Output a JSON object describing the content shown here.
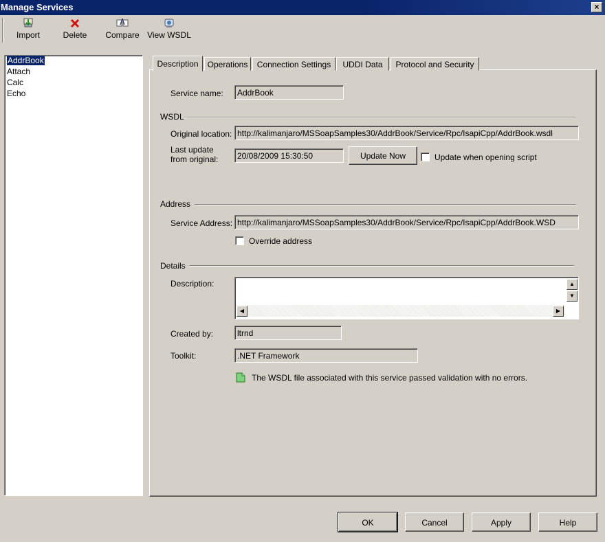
{
  "window": {
    "title": "Manage Services",
    "close_glyph": "×"
  },
  "toolbar": {
    "buttons": [
      {
        "label": "Import",
        "icon": "import-icon"
      },
      {
        "label": "Delete",
        "icon": "delete-icon"
      },
      {
        "label": "Compare",
        "icon": "compare-icon"
      },
      {
        "label": "View WSDL",
        "icon": "view-wsdl-icon"
      }
    ]
  },
  "services": [
    "AddrBook",
    "Attach",
    "Calc",
    "Echo"
  ],
  "selected_service": "AddrBook",
  "tabs": [
    "Description",
    "Operations",
    "Connection Settings",
    "UDDI Data",
    "Protocol and Security"
  ],
  "active_tab": "Description",
  "description": {
    "service_name_label": "Service name:",
    "service_name": "AddrBook",
    "wsdl_group": "WSDL",
    "original_location_label": "Original location:",
    "original_location": "http://kalimanjaro/MSSoapSamples30/AddrBook/Service/Rpc/IsapiCpp/AddrBook.wsdl",
    "last_update_label_1": "Last update",
    "last_update_label_2": "from original:",
    "last_update": "20/08/2009 15:30:50",
    "update_now_label": "Update Now",
    "update_when_opening_label": "Update when opening script",
    "update_when_opening_checked": false,
    "address_group": "Address",
    "service_address_label": "Service Address:",
    "service_address": "http://kalimanjaro/MSSoapSamples30/AddrBook/Service/Rpc/IsapiCpp/AddrBook.WSD",
    "override_address_label": "Override address",
    "override_address_checked": false,
    "details_group": "Details",
    "description_label": "Description:",
    "description_value": "",
    "created_by_label": "Created by:",
    "created_by": "ltrnd",
    "toolkit_label": "Toolkit:",
    "toolkit": ".NET Framework",
    "validation_message": "The WSDL file associated with this service passed validation with no errors.",
    "validation_icon": "validation-ok-icon"
  },
  "footer": {
    "ok_label": "OK",
    "cancel_label": "Cancel",
    "apply_label": "Apply",
    "help_label": "Help"
  }
}
